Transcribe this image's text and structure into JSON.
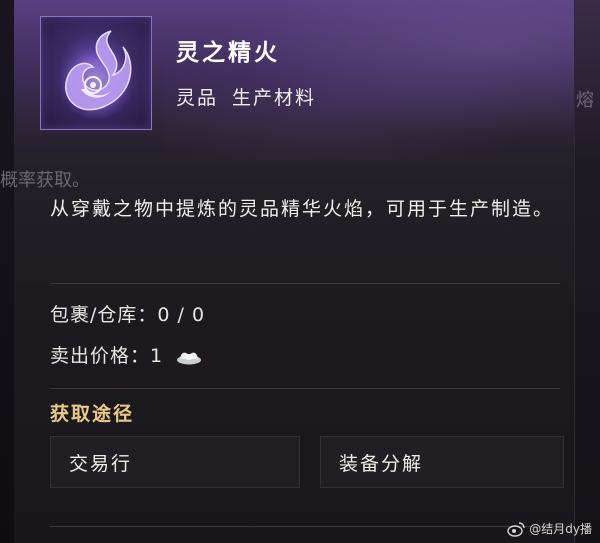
{
  "background": {
    "left_fragment": "概率获取。",
    "right_fragment": "熔"
  },
  "item": {
    "name": "灵之精火",
    "quality": "灵品",
    "category": "生产材料",
    "icon": "purple-spirit-flame-icon",
    "description": "从穿戴之物中提炼的灵品精华火焰，可用于生产制造。"
  },
  "stats": {
    "stock_label": "包裹/仓库：",
    "stock_value": "0 / 0",
    "price_label": "卖出价格：",
    "price_value": "1",
    "price_icon": "silver-ingot-icon"
  },
  "sources": {
    "title": "获取途径",
    "items": [
      "交易行",
      "装备分解"
    ]
  },
  "watermark": {
    "text": "@结月dy播"
  },
  "colors": {
    "accent_gold": "#e9c986",
    "header_purple": "#5a3f83",
    "panel": "#1d1a1f"
  }
}
